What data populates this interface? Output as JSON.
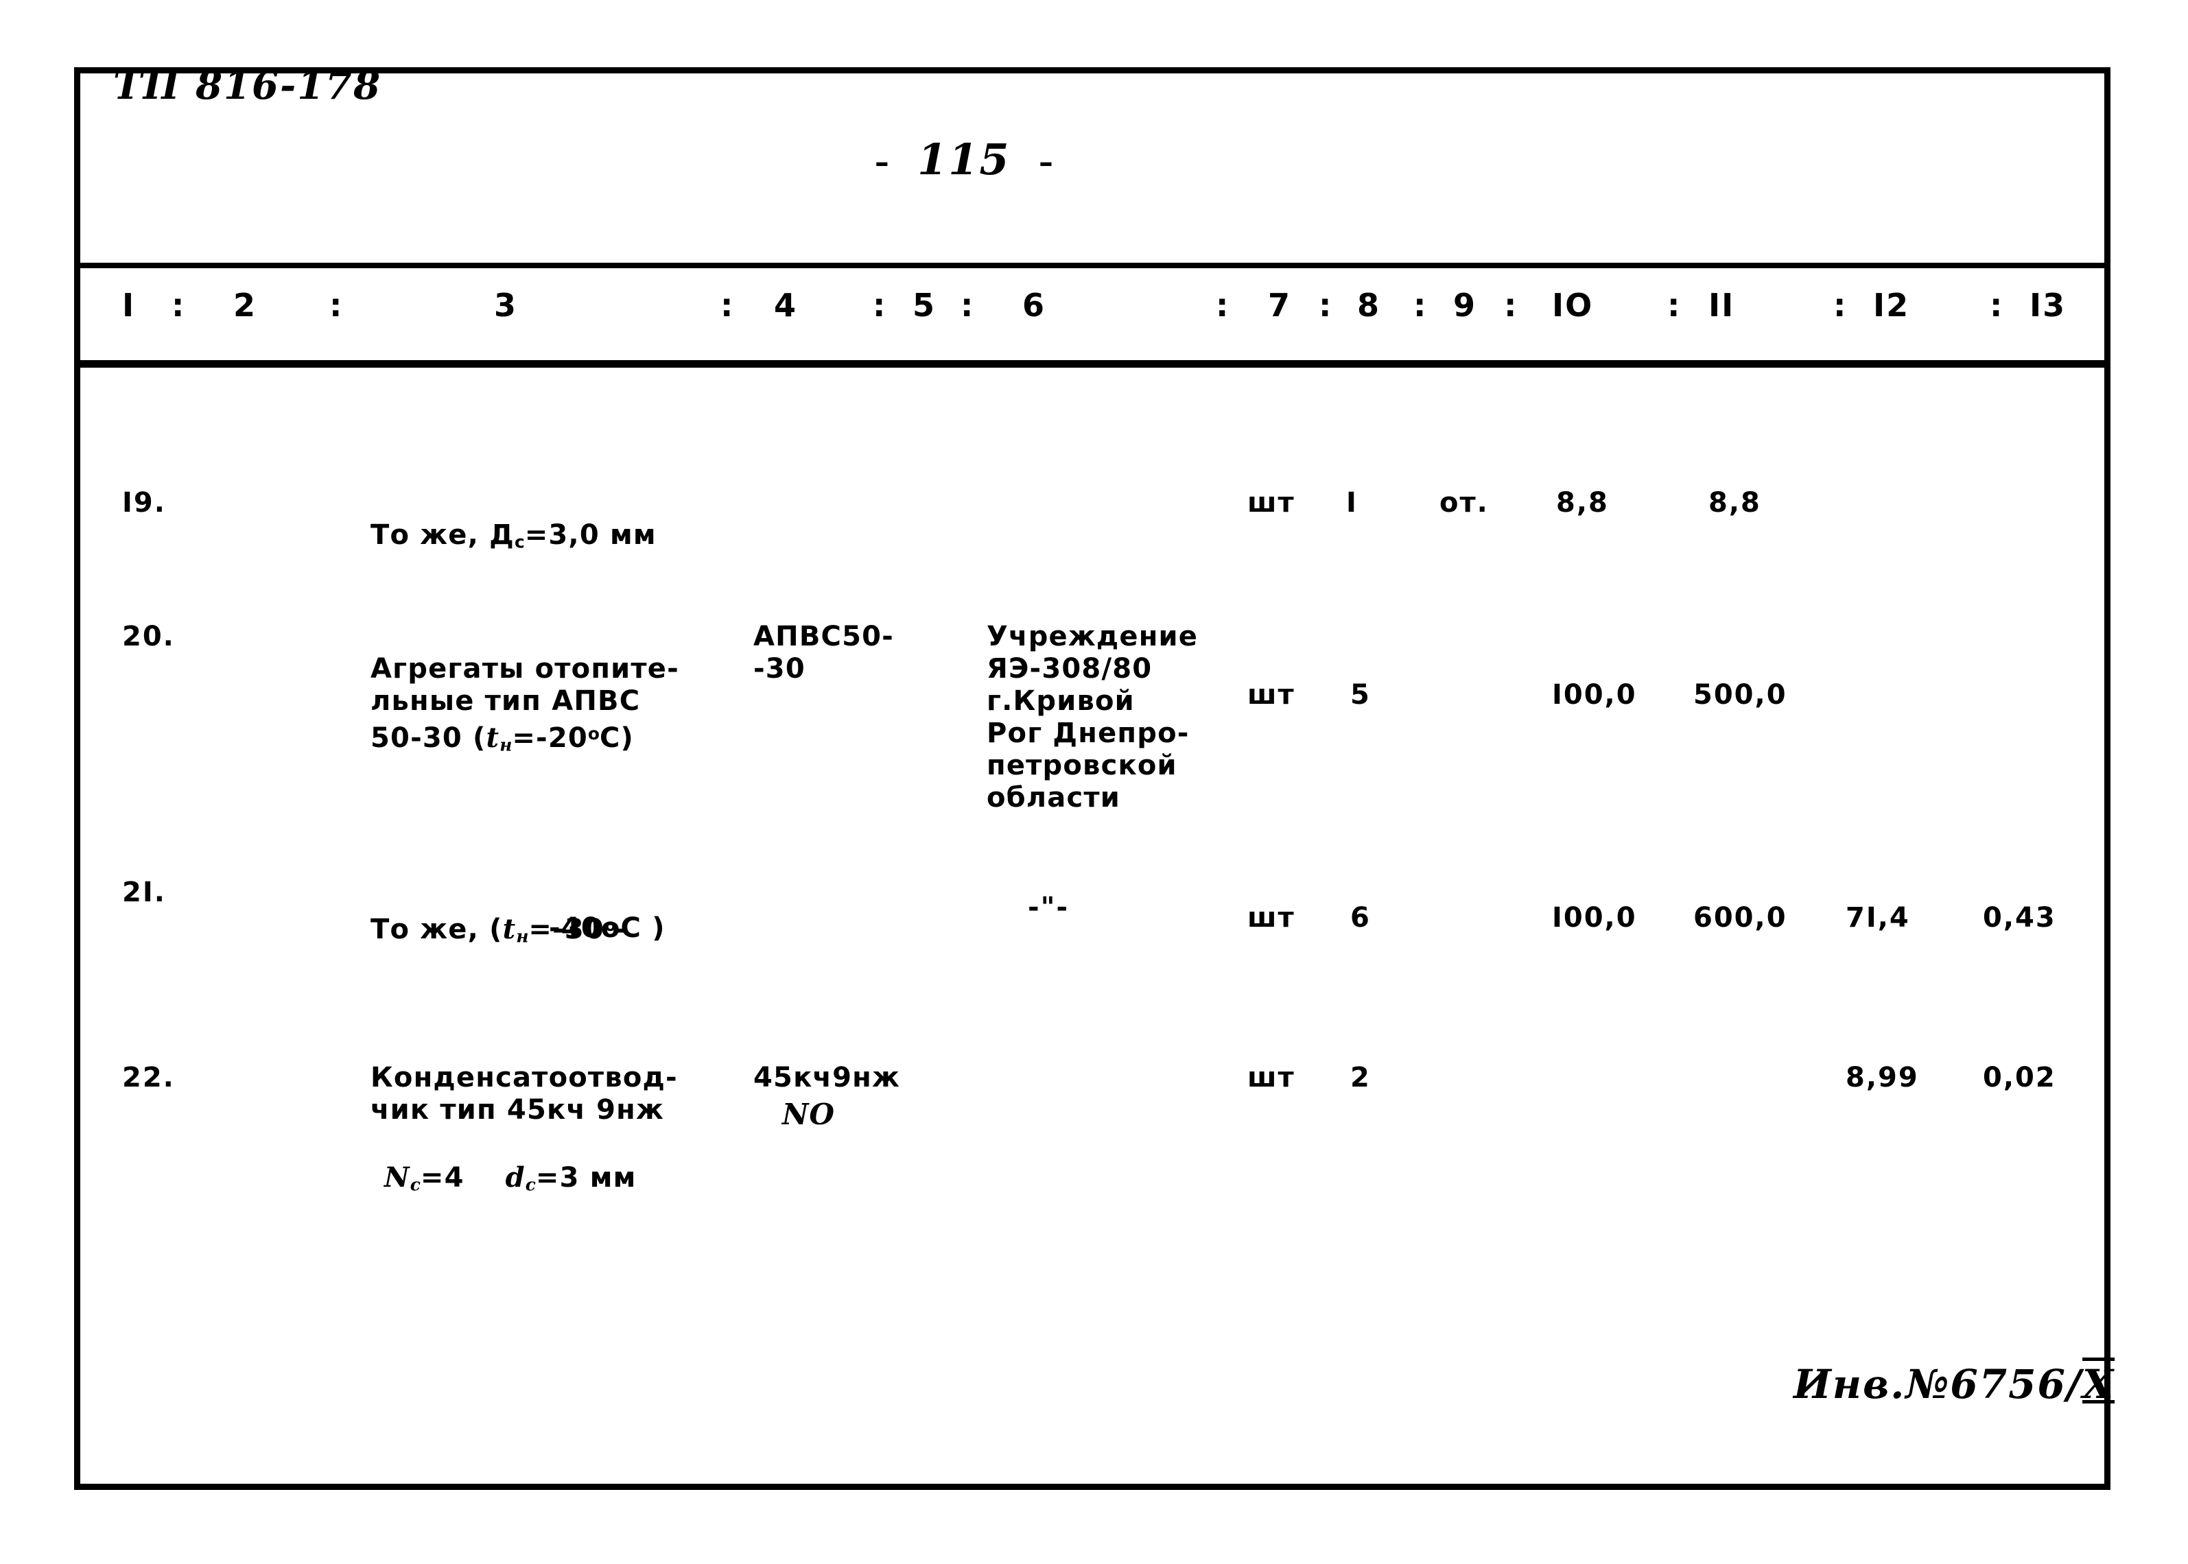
{
  "document": {
    "code": "ТП 816-178",
    "page_marker_left": "-",
    "page_number": "115",
    "page_marker_right": "-",
    "inventory_stamp_prefix": "Инв.№6756/",
    "inventory_stamp_suffix": "Х"
  },
  "table": {
    "column_headers": [
      "I",
      "2",
      "3",
      "4",
      "5",
      "6",
      "7",
      "8",
      "9",
      "IO",
      "II",
      "I2",
      "I3"
    ],
    "separator": ":",
    "rows": [
      {
        "no": "I9.",
        "name_line1": "То же, Д",
        "name_sub": "с",
        "name_line1b": "=3,0 мм",
        "type": "",
        "supplier": "",
        "unit": "шт",
        "qty": "I",
        "col8": "от.",
        "col9": "8,8",
        "col10": "8,8",
        "col11": "",
        "col12": ""
      },
      {
        "no": "20.",
        "name": "Агрегаты отопите-\nльные тип АПВС\n50-30 (",
        "name_var": "t",
        "name_var_sub": "н",
        "name_tail": "=-20",
        "name_deg": "о",
        "name_tail2": "С)",
        "type": "АПВС50-\n-30",
        "supplier": "Учреждение\nЯЭ-308/80\nг.Кривой\nРог Днепро-\nпетровской\nобласти",
        "unit": "шт",
        "qty": "5",
        "col8": "",
        "col9": "I00,0",
        "col10": "500,0",
        "col11": "",
        "col12": ""
      },
      {
        "no": "2I.",
        "name_pre": "То же, (",
        "name_var": "t",
        "name_var_sub": "н",
        "name_mid": "=-30",
        "name_sup": "о",
        "name_dash": "-",
        "name_line2": "-40оС )",
        "type": "",
        "supplier": "-\"-",
        "unit": "шт",
        "qty": "6",
        "col8": "",
        "col9": "I00,0",
        "col10": "600,0",
        "col11": "7I,4",
        "col12": "0,43"
      },
      {
        "no": "22.",
        "name_line1": "Конденсатоотвод-\nчик тип 45кч 9нж",
        "name_n": "N",
        "name_n_sub": "с",
        "name_n_val": "=4",
        "name_d": "d",
        "name_d_sub": "с",
        "name_d_val": "=3 мм",
        "type": "45кч9нж",
        "type_hand": "NO",
        "supplier": "",
        "unit": "шт",
        "qty": "2",
        "col8": "",
        "col9": "",
        "col10": "",
        "col11": "8,99",
        "col12": "0,02"
      }
    ]
  }
}
